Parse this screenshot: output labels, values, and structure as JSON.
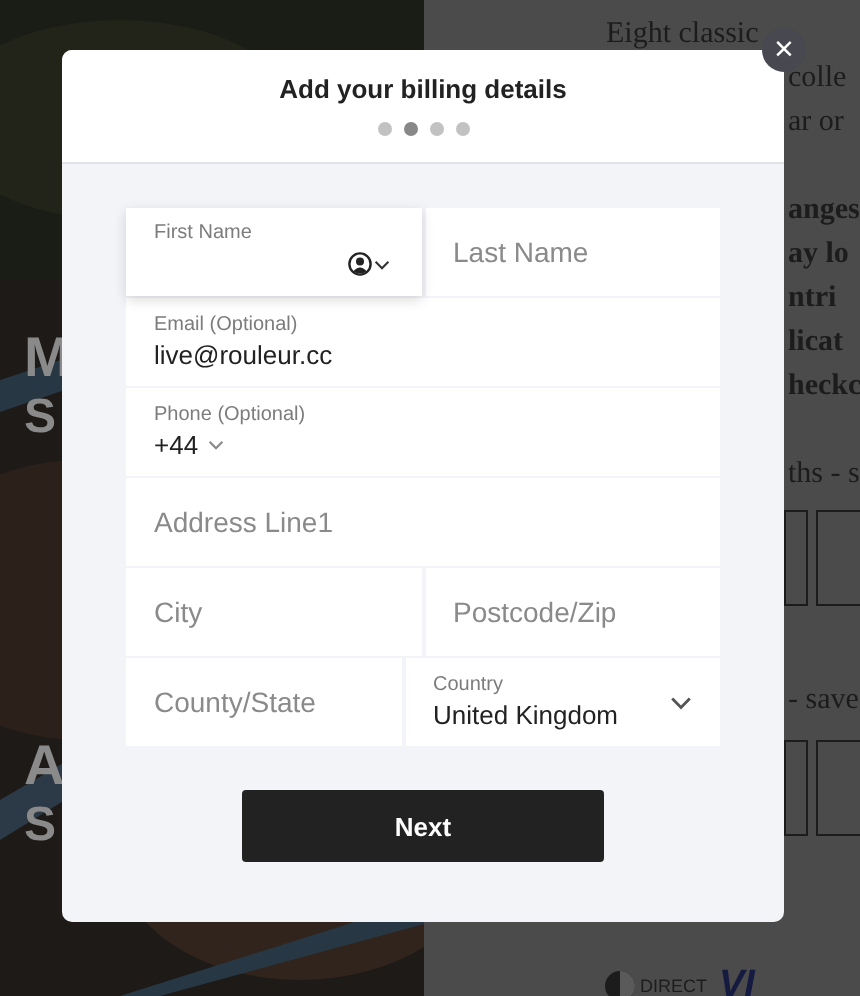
{
  "background": {
    "hero_letters": [
      "M",
      "S",
      "A",
      "S"
    ],
    "lines": [
      {
        "text": "Eight classic",
        "bold": false,
        "indent": true
      },
      {
        "text": "colle",
        "bold": false,
        "indent": false
      },
      {
        "text": "ar or",
        "bold": false,
        "indent": false
      },
      {
        "text": "anges",
        "bold": true,
        "indent": false
      },
      {
        "text": "ay lo",
        "bold": true,
        "indent": false
      },
      {
        "text": "ntri",
        "bold": true,
        "indent": false
      },
      {
        "text": "licat",
        "bold": true,
        "indent": false
      },
      {
        "text": "heckc",
        "bold": true,
        "indent": false
      },
      {
        "text": "ths - s",
        "bold": false,
        "indent": false
      },
      {
        "text": "- save",
        "bold": false,
        "indent": false
      }
    ],
    "logos": [
      "DIRECT",
      "VI"
    ]
  },
  "modal": {
    "close": "×",
    "title": "Add your billing details",
    "steps": [
      {
        "selected": false
      },
      {
        "selected": true
      },
      {
        "selected": false
      },
      {
        "selected": false
      }
    ],
    "rows": [
      [
        {
          "kind": "floating",
          "label": "First Name",
          "focused": true
        },
        {
          "kind": "placeholder",
          "placeholder": "Last Name",
          "focused": false
        }
      ],
      [
        {
          "kind": "labeled",
          "label": "Email (Optional)",
          "value": "live@rouleur.cc",
          "focused": false
        }
      ],
      [
        {
          "kind": "phone",
          "label": "Phone (Optional)",
          "value": "+44",
          "focused": false
        }
      ],
      [
        {
          "kind": "placeholder",
          "placeholder": "Address Line1",
          "focused": false
        }
      ],
      [
        {
          "kind": "placeholder",
          "placeholder": "City",
          "focused": false
        },
        {
          "kind": "placeholder",
          "placeholder": "Postcode/Zip",
          "focused": false
        }
      ],
      [
        {
          "kind": "placeholder",
          "placeholder": "County/State",
          "focused": false
        },
        {
          "kind": "select",
          "label": "Country",
          "value": "United Kingdom",
          "focused": false
        }
      ]
    ],
    "button": "Next"
  }
}
